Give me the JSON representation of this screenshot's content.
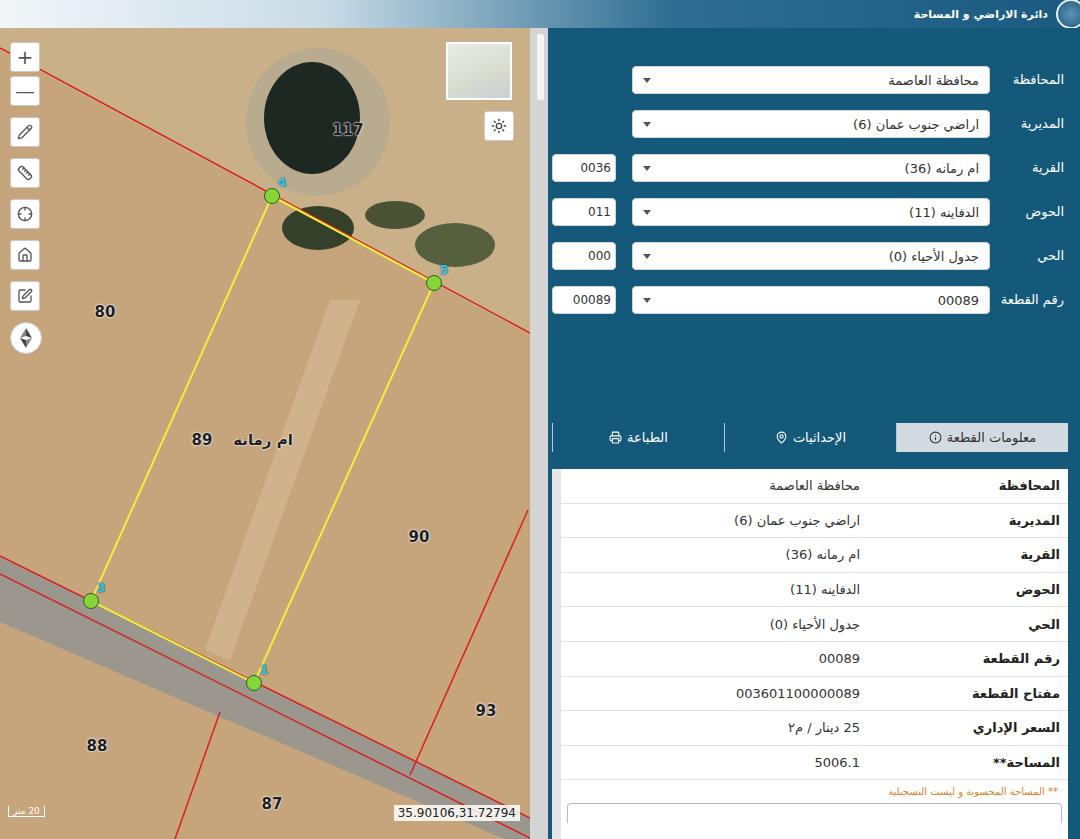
{
  "header": {
    "title": "دائرة الاراضي و المساحة"
  },
  "map": {
    "zoom_in": "+",
    "zoom_out": "—",
    "parcel_labels": [
      "117",
      "80",
      "89",
      "90",
      "93",
      "88",
      "87"
    ],
    "village_label": "ام رمانه",
    "vertices": [
      "4",
      "5",
      "1",
      "3"
    ],
    "coordinates": "35.90106,31.72794",
    "scale": "20 متر"
  },
  "form": {
    "fields": [
      {
        "label": "المحافظة",
        "value": "محافظة العاصمة",
        "code": ""
      },
      {
        "label": "المديرية",
        "value": "اراضي جنوب عمان (6)",
        "code": ""
      },
      {
        "label": "القرية",
        "value": "ام رمانه (36)",
        "code": "0036"
      },
      {
        "label": "الحوض",
        "value": "الدفاينه (11)",
        "code": "011"
      },
      {
        "label": "الحي",
        "value": "جدول الأحياء (0)",
        "code": "000"
      },
      {
        "label": "رقم القطعة",
        "value": "00089",
        "code": "00089"
      }
    ]
  },
  "tabs": [
    {
      "label": "معلومات القطعة",
      "selected": true
    },
    {
      "label": "الإحداثيات",
      "selected": false
    },
    {
      "label": "الطباعة",
      "selected": false
    }
  ],
  "info": {
    "rows": [
      {
        "label": "المحافظة",
        "value": "محافظة العاصمة"
      },
      {
        "label": "المديرية",
        "value": "اراضي جنوب عمان (6)"
      },
      {
        "label": "القرية",
        "value": "ام رمانه (36)"
      },
      {
        "label": "الحوض",
        "value": "الدفاينه (11)"
      },
      {
        "label": "الحي",
        "value": "جدول الأحياء (0)"
      },
      {
        "label": "رقم القطعة",
        "value": "00089"
      },
      {
        "label": "مفتاح القطعة",
        "value": "003601100000089"
      },
      {
        "label": "السعر الإداري",
        "value": "25 دينار / م٢"
      },
      {
        "label": "المساحة**",
        "value": "5006.1"
      }
    ],
    "note": "** المساحة المحسوبة و ليست التسجيلية"
  }
}
